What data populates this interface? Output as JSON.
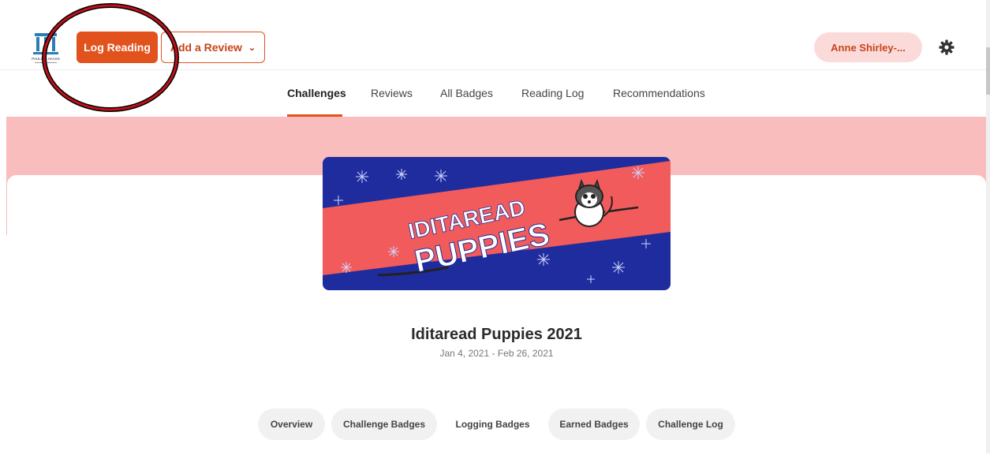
{
  "header": {
    "logo_text": "PAULINE HAASS",
    "log_reading_label": "Log Reading",
    "add_review_label": "Add a Review",
    "user_name": "Anne Shirley-..."
  },
  "tabs": [
    {
      "label": "Challenges",
      "active": true
    },
    {
      "label": "Reviews"
    },
    {
      "label": "All Badges"
    },
    {
      "label": "Reading Log"
    },
    {
      "label": "Recommendations"
    }
  ],
  "banner": {
    "line1": "IDITAREAD",
    "line2": "PUPPIES"
  },
  "challenge": {
    "title": "Iditaread Puppies 2021",
    "dates": "Jan 4, 2021 - Feb 26, 2021"
  },
  "subtabs": [
    {
      "label": "Overview"
    },
    {
      "label": "Challenge Badges"
    },
    {
      "label": "Logging Badges"
    },
    {
      "label": "Earned Badges"
    },
    {
      "label": "Challenge Log"
    }
  ],
  "colors": {
    "accent": "#e1521d",
    "banner_pink": "#f9bdbd",
    "badge_blue": "#1f2c9e",
    "badge_red": "#f25b5b",
    "annotation": "#c0101a"
  },
  "icons": {
    "settings": "gear-icon",
    "dropdown": "chevron-down-icon"
  }
}
